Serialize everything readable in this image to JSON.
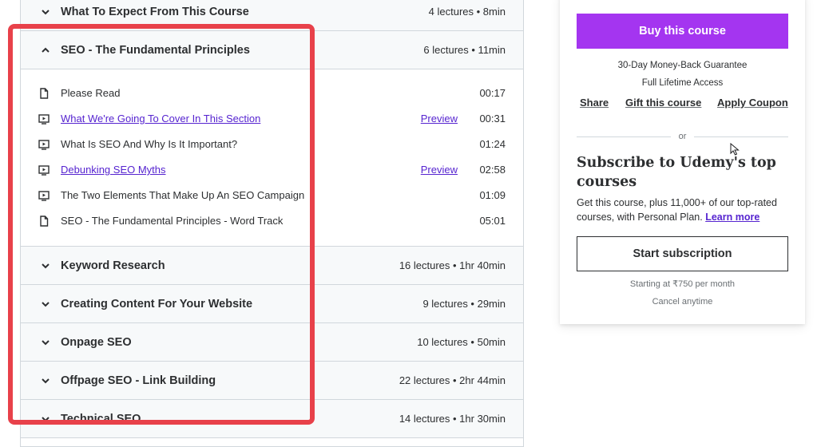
{
  "curriculum": {
    "sections": [
      {
        "title": "What To Expect From This Course",
        "meta": "4 lectures • 8min",
        "expanded": false
      },
      {
        "title": "SEO - The Fundamental Principles",
        "meta": "6 lectures • 11min",
        "expanded": true
      },
      {
        "title": "Keyword Research",
        "meta": "16 lectures • 1hr 40min",
        "expanded": false
      },
      {
        "title": "Creating Content For Your Website",
        "meta": "9 lectures • 29min",
        "expanded": false
      },
      {
        "title": "Onpage SEO",
        "meta": "10 lectures • 50min",
        "expanded": false
      },
      {
        "title": "Offpage SEO - Link Building",
        "meta": "22 lectures • 2hr 44min",
        "expanded": false
      },
      {
        "title": "Technical SEO",
        "meta": "14 lectures • 1hr 30min",
        "expanded": false
      }
    ],
    "lectures": [
      {
        "icon": "document-icon",
        "title": "Please Read",
        "preview": "",
        "duration": "00:17",
        "link": false
      },
      {
        "icon": "video-icon",
        "title": "What We're Going To Cover In This Section",
        "preview": "Preview",
        "duration": "00:31",
        "link": true
      },
      {
        "icon": "video-icon",
        "title": "What Is SEO And Why Is It Important?",
        "preview": "",
        "duration": "01:24",
        "link": false
      },
      {
        "icon": "video-icon",
        "title": "Debunking SEO Myths",
        "preview": "Preview",
        "duration": "02:58",
        "link": true
      },
      {
        "icon": "video-icon",
        "title": "The Two Elements That Make Up An SEO Campaign",
        "preview": "",
        "duration": "01:09",
        "link": false
      },
      {
        "icon": "document-icon",
        "title": "SEO - The Fundamental Principles - Word Track",
        "preview": "",
        "duration": "05:01",
        "link": false
      }
    ]
  },
  "sidebar": {
    "buy_label": "Buy this course",
    "guarantee": "30-Day Money-Back Guarantee",
    "lifetime": "Full Lifetime Access",
    "share": "Share",
    "gift": "Gift this course",
    "coupon": "Apply Coupon",
    "or": "or",
    "subscribe_title": "Subscribe to Udemy's top courses",
    "subscribe_desc": "Get this course, plus 11,000+ of our top-rated courses, with Personal Plan.",
    "learn_more": "Learn more",
    "start_label": "Start subscription",
    "starting_at": "Starting at ₹750 per month",
    "cancel": "Cancel anytime"
  },
  "colors": {
    "accent_purple": "#a435f0",
    "link_purple": "#5624d0",
    "highlight_red": "#e8414a"
  }
}
